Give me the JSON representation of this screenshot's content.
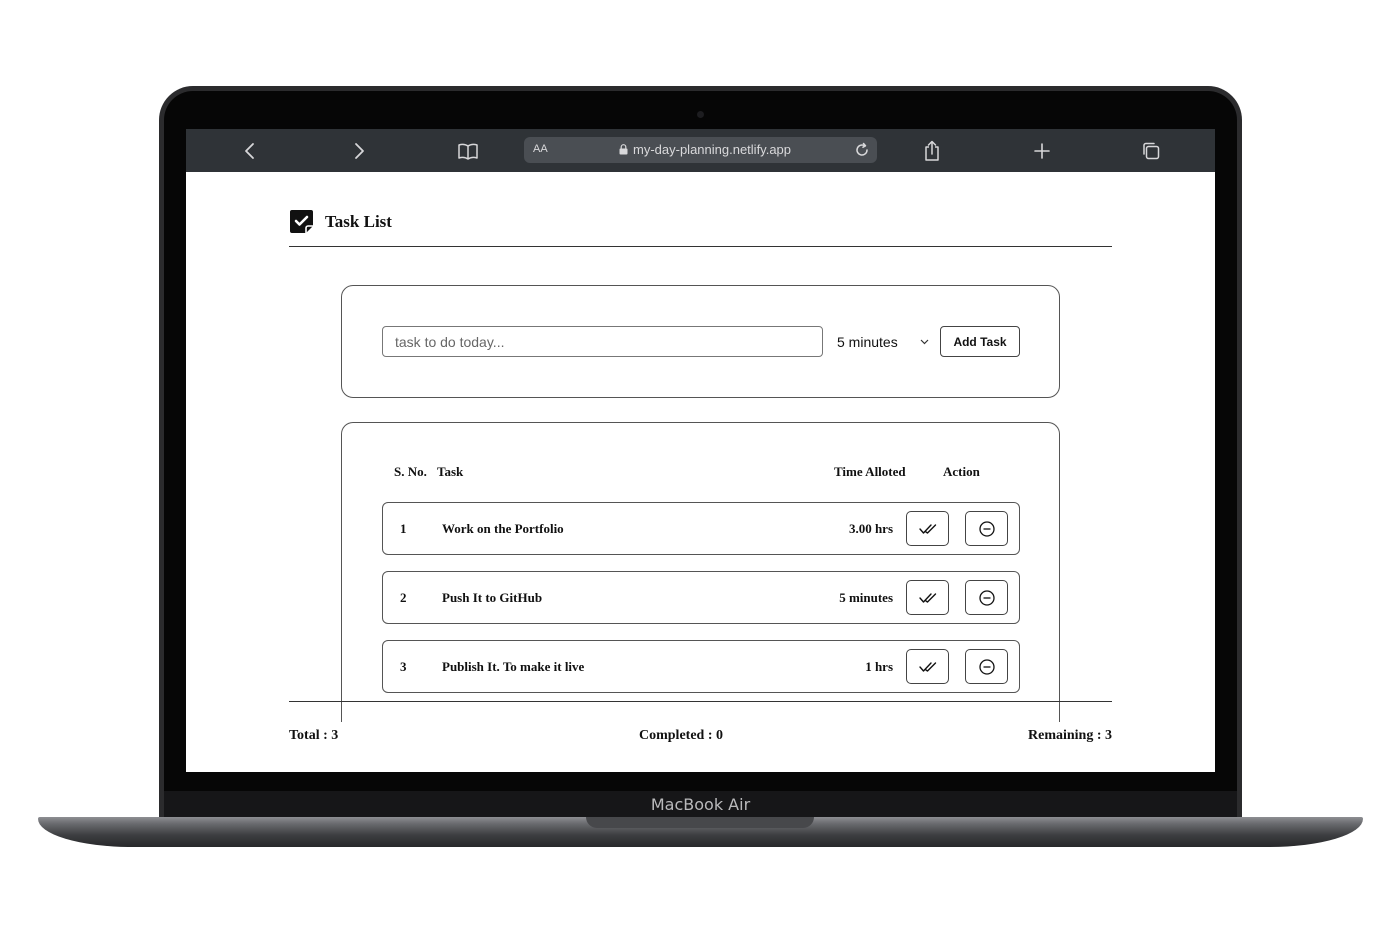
{
  "device": {
    "brand": "MacBook Air"
  },
  "browser": {
    "url": "my-day-planning.netlify.app",
    "reader_label": "AA",
    "icons": [
      "back-icon",
      "forward-icon",
      "bookmarks-icon",
      "lock-icon",
      "reload-icon",
      "share-icon",
      "new-tab-icon",
      "tabs-icon"
    ]
  },
  "app": {
    "title": "Task List",
    "form": {
      "placeholder": "task to do today...",
      "time_value": "5 minutes",
      "add_label": "Add Task"
    },
    "table": {
      "headers": {
        "sno": "S. No.",
        "task": "Task",
        "time": "Time Alloted",
        "action": "Action"
      },
      "rows": [
        {
          "num": "1",
          "task": "Work on the Portfolio",
          "time": "3.00 hrs"
        },
        {
          "num": "2",
          "task": "Push It to GitHub",
          "time": "5 minutes"
        },
        {
          "num": "3",
          "task": "Publish It. To make it live",
          "time": "1 hrs"
        }
      ]
    },
    "stats": {
      "total": "Total : 3",
      "completed": "Completed : 0",
      "remaining": "Remaining : 3"
    }
  }
}
